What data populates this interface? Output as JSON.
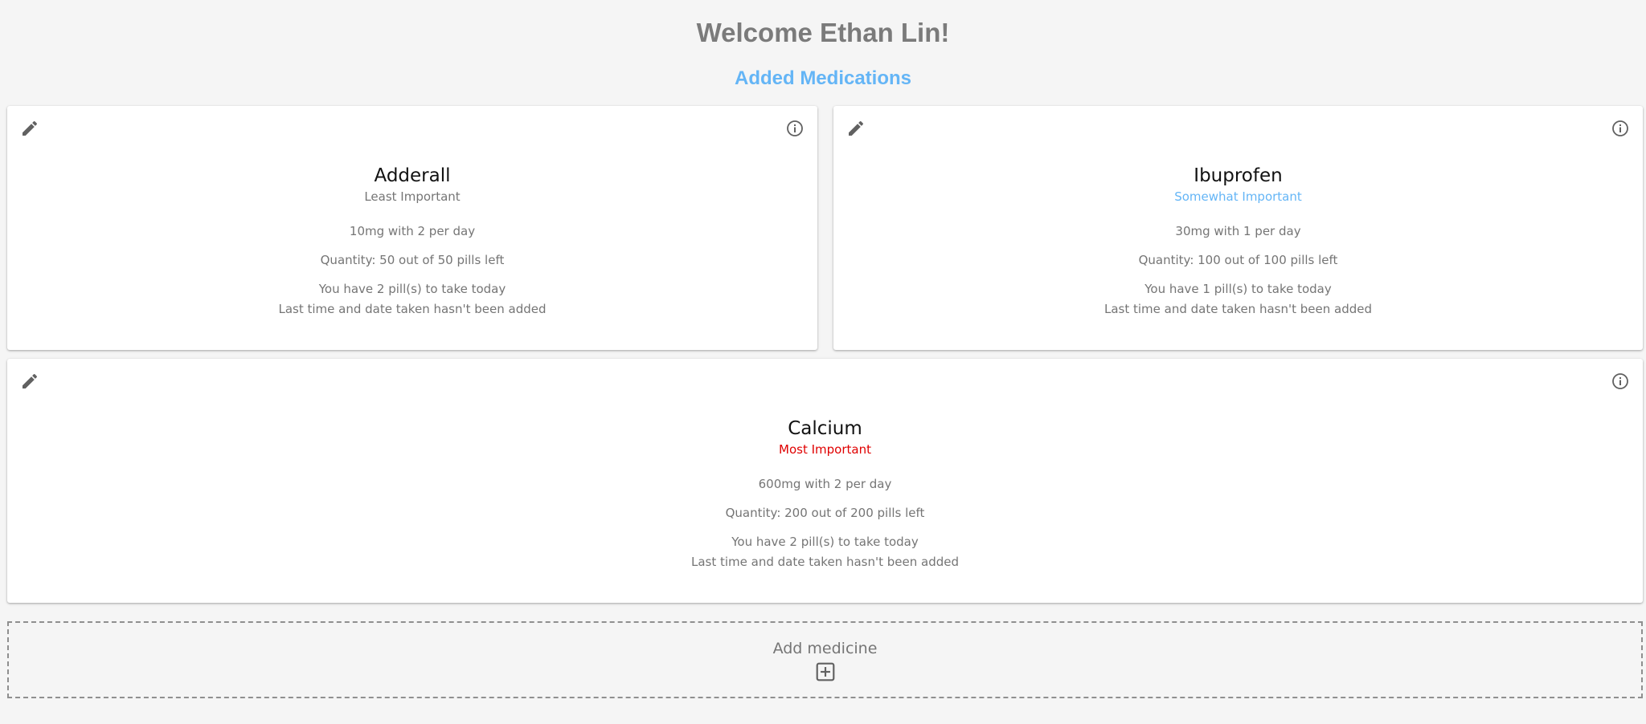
{
  "header": {
    "welcome": "Welcome Ethan Lin!",
    "section_title": "Added Medications"
  },
  "colors": {
    "welcome": "#7b7b7b",
    "section_title": "#64b5f6",
    "least_important": "#757575",
    "somewhat_important": "#64b5f6",
    "most_important": "#e00000",
    "icon": "#616161"
  },
  "medications": [
    {
      "name": "Adderall",
      "priority": "Least Important",
      "priority_color": "#757575",
      "dose": "10mg with 2 per day",
      "quantity": "Quantity: 50 out of 50 pills left",
      "today": "You have 2 pill(s) to take today",
      "last_taken": "Last time and date taken hasn't been added",
      "edit_icon": "pencil-icon",
      "info_icon": "info-circle-icon"
    },
    {
      "name": "Ibuprofen",
      "priority": "Somewhat Important",
      "priority_color": "#64b5f6",
      "dose": "30mg with 1 per day",
      "quantity": "Quantity: 100 out of 100 pills left",
      "today": "You have 1 pill(s) to take today",
      "last_taken": "Last time and date taken hasn't been added",
      "edit_icon": "pencil-icon",
      "info_icon": "info-circle-icon"
    },
    {
      "name": "Calcium",
      "priority": "Most Important",
      "priority_color": "#e00000",
      "dose": "600mg with 2 per day",
      "quantity": "Quantity: 200 out of 200 pills left",
      "today": "You have 2 pill(s) to take today",
      "last_taken": "Last time and date taken hasn't been added",
      "edit_icon": "pencil-icon",
      "info_icon": "info-circle-icon"
    }
  ],
  "add_medicine": {
    "label": "Add medicine",
    "icon": "plus-square-icon"
  }
}
